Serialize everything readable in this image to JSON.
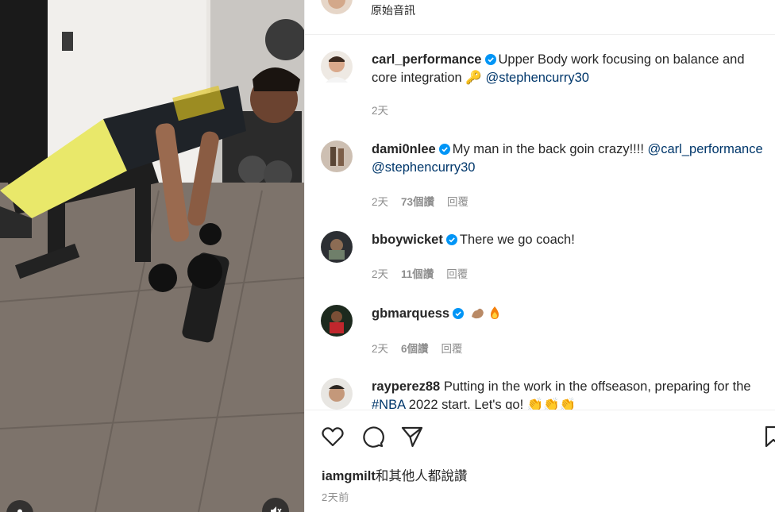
{
  "post": {
    "audio_label": "原始音訊"
  },
  "comments": [
    {
      "username": "carl_performance",
      "text": "Upper Body work focusing on balance and core integration 🔑 ",
      "mention": "@stephencurry30",
      "time": "2天",
      "likes": "",
      "reply": ""
    },
    {
      "username": "dami0nlee",
      "text": "My man in the back goin crazy!!!! ",
      "mention": "@carl_performance @stephencurry30",
      "time": "2天",
      "likes": "73個讚",
      "reply": "回覆"
    },
    {
      "username": "bboywicket",
      "text": "There we go coach!",
      "time": "2天",
      "likes": "11個讚",
      "reply": "回覆"
    },
    {
      "username": "gbmarquess",
      "emojis": [
        "flexed-biceps-icon",
        "fire-icon"
      ],
      "time": "2天",
      "likes": "6個讚",
      "reply": "回覆"
    },
    {
      "username": "rayperez88",
      "text": "Putting in the work in the offseason, preparing for the ",
      "hashtag": "#NBA",
      "text_tail": " 2022 start. Let's go! 👏👏👏"
    }
  ],
  "actions": {
    "icons": [
      "heart-icon",
      "comment-icon",
      "share-icon",
      "bookmark-icon"
    ],
    "liked_by_user": "iamgmilt",
    "liked_by_suffix": "和其他人都說讚",
    "post_time": "2天前"
  },
  "colors": {
    "verified": "#0095f6",
    "mention": "#00376b",
    "muted": "#8e8e8e",
    "text": "#262626",
    "divider": "#efefef"
  }
}
